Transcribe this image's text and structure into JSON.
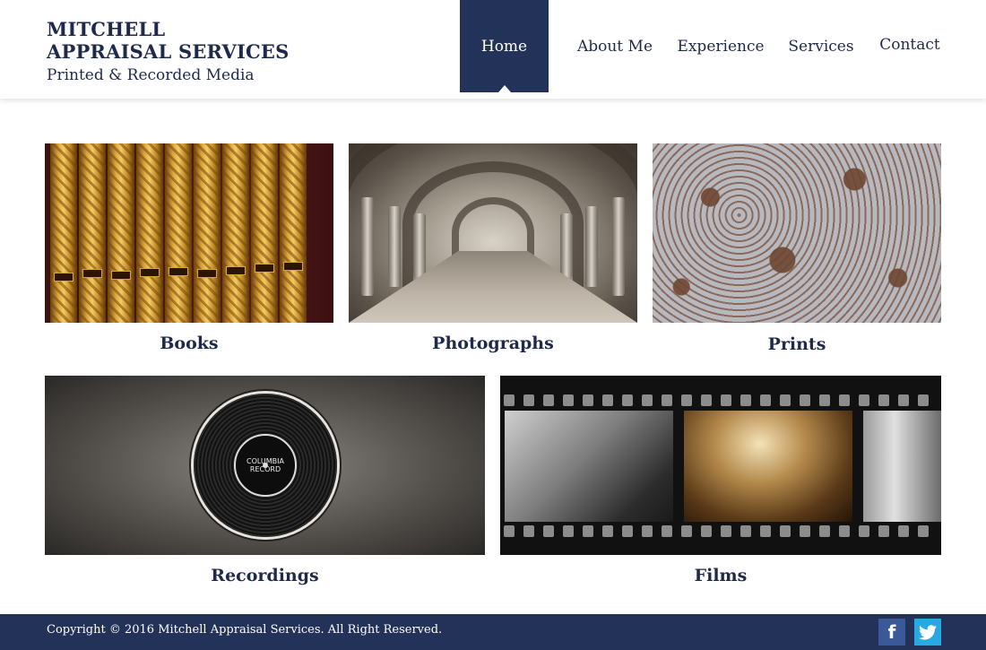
{
  "brand": {
    "line1": "MITCHELL",
    "line2": "APPRAISAL SERVICES",
    "tagline": "Printed & Recorded Media"
  },
  "nav": {
    "home": "Home",
    "about": "About Me",
    "experience": "Experience",
    "services": "Services",
    "contact": "Contact",
    "active": "Home"
  },
  "tiles": {
    "books": "Books",
    "photographs": "Photographs",
    "prints": "Prints",
    "recordings": "Recordings",
    "films": "Films"
  },
  "record_label": {
    "line1": "COLUMBIA",
    "line2": "RECORD"
  },
  "footer": {
    "copyright": "Copyright © 2016 Mitchell Appraisal Services. All Right Reserved.",
    "facebook_icon": "facebook-icon",
    "twitter_icon": "twitter-icon"
  },
  "colors": {
    "navy": "#223259",
    "text": "#1f2a4a",
    "facebook": "#3b5998",
    "twitter": "#29a9e1"
  }
}
